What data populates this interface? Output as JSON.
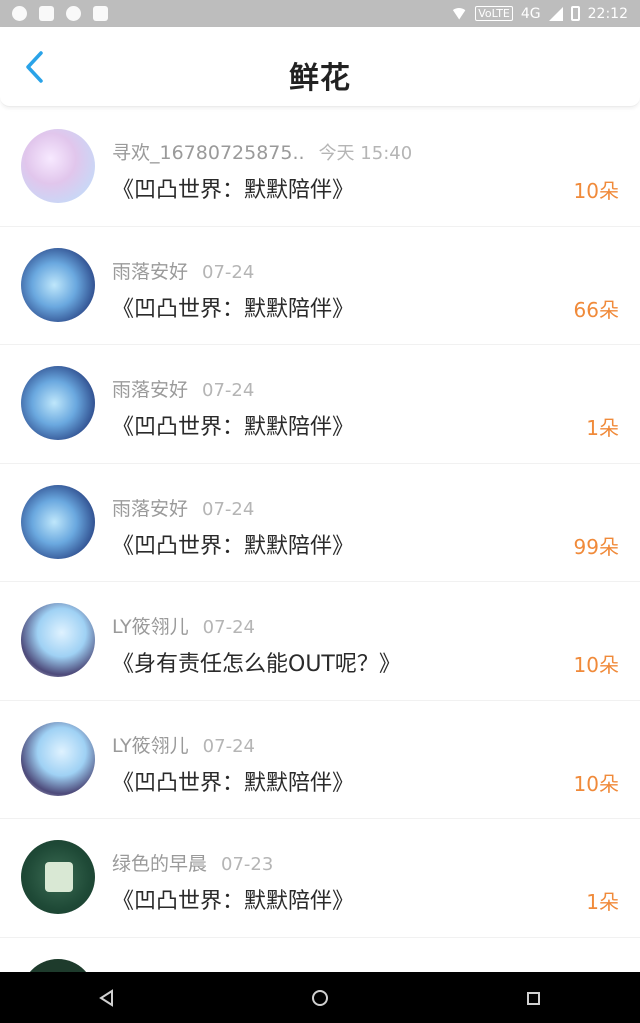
{
  "status_bar": {
    "volte": "VoLTE",
    "network": "4G",
    "time": "22:12"
  },
  "header": {
    "title": "鲜花",
    "back_icon": "chevron-left-icon"
  },
  "colors": {
    "accent_blue": "#2aa3e8",
    "count_orange": "#f08a3a"
  },
  "list": [
    {
      "name": "寻欢_16780725875..",
      "time": "今天 15:40",
      "book": "《凹凸世界：默默陪伴》",
      "count": "10朵"
    },
    {
      "name": "雨落安好",
      "time": "07-24",
      "book": "《凹凸世界：默默陪伴》",
      "count": "66朵"
    },
    {
      "name": "雨落安好",
      "time": "07-24",
      "book": "《凹凸世界：默默陪伴》",
      "count": "1朵"
    },
    {
      "name": "雨落安好",
      "time": "07-24",
      "book": "《凹凸世界：默默陪伴》",
      "count": "99朵"
    },
    {
      "name": "LY筱翎儿",
      "time": "07-24",
      "book": "《身有责任怎么能OUT呢？》",
      "count": "10朵"
    },
    {
      "name": "LY筱翎儿",
      "time": "07-24",
      "book": "《凹凸世界：默默陪伴》",
      "count": "10朵"
    },
    {
      "name": "绿色的早晨",
      "time": "07-23",
      "book": "《凹凸世界：默默陪伴》",
      "count": "1朵"
    }
  ],
  "nav": {
    "back_icon": "triangle-back-icon",
    "home_icon": "circle-home-icon",
    "recents_icon": "square-recents-icon"
  }
}
